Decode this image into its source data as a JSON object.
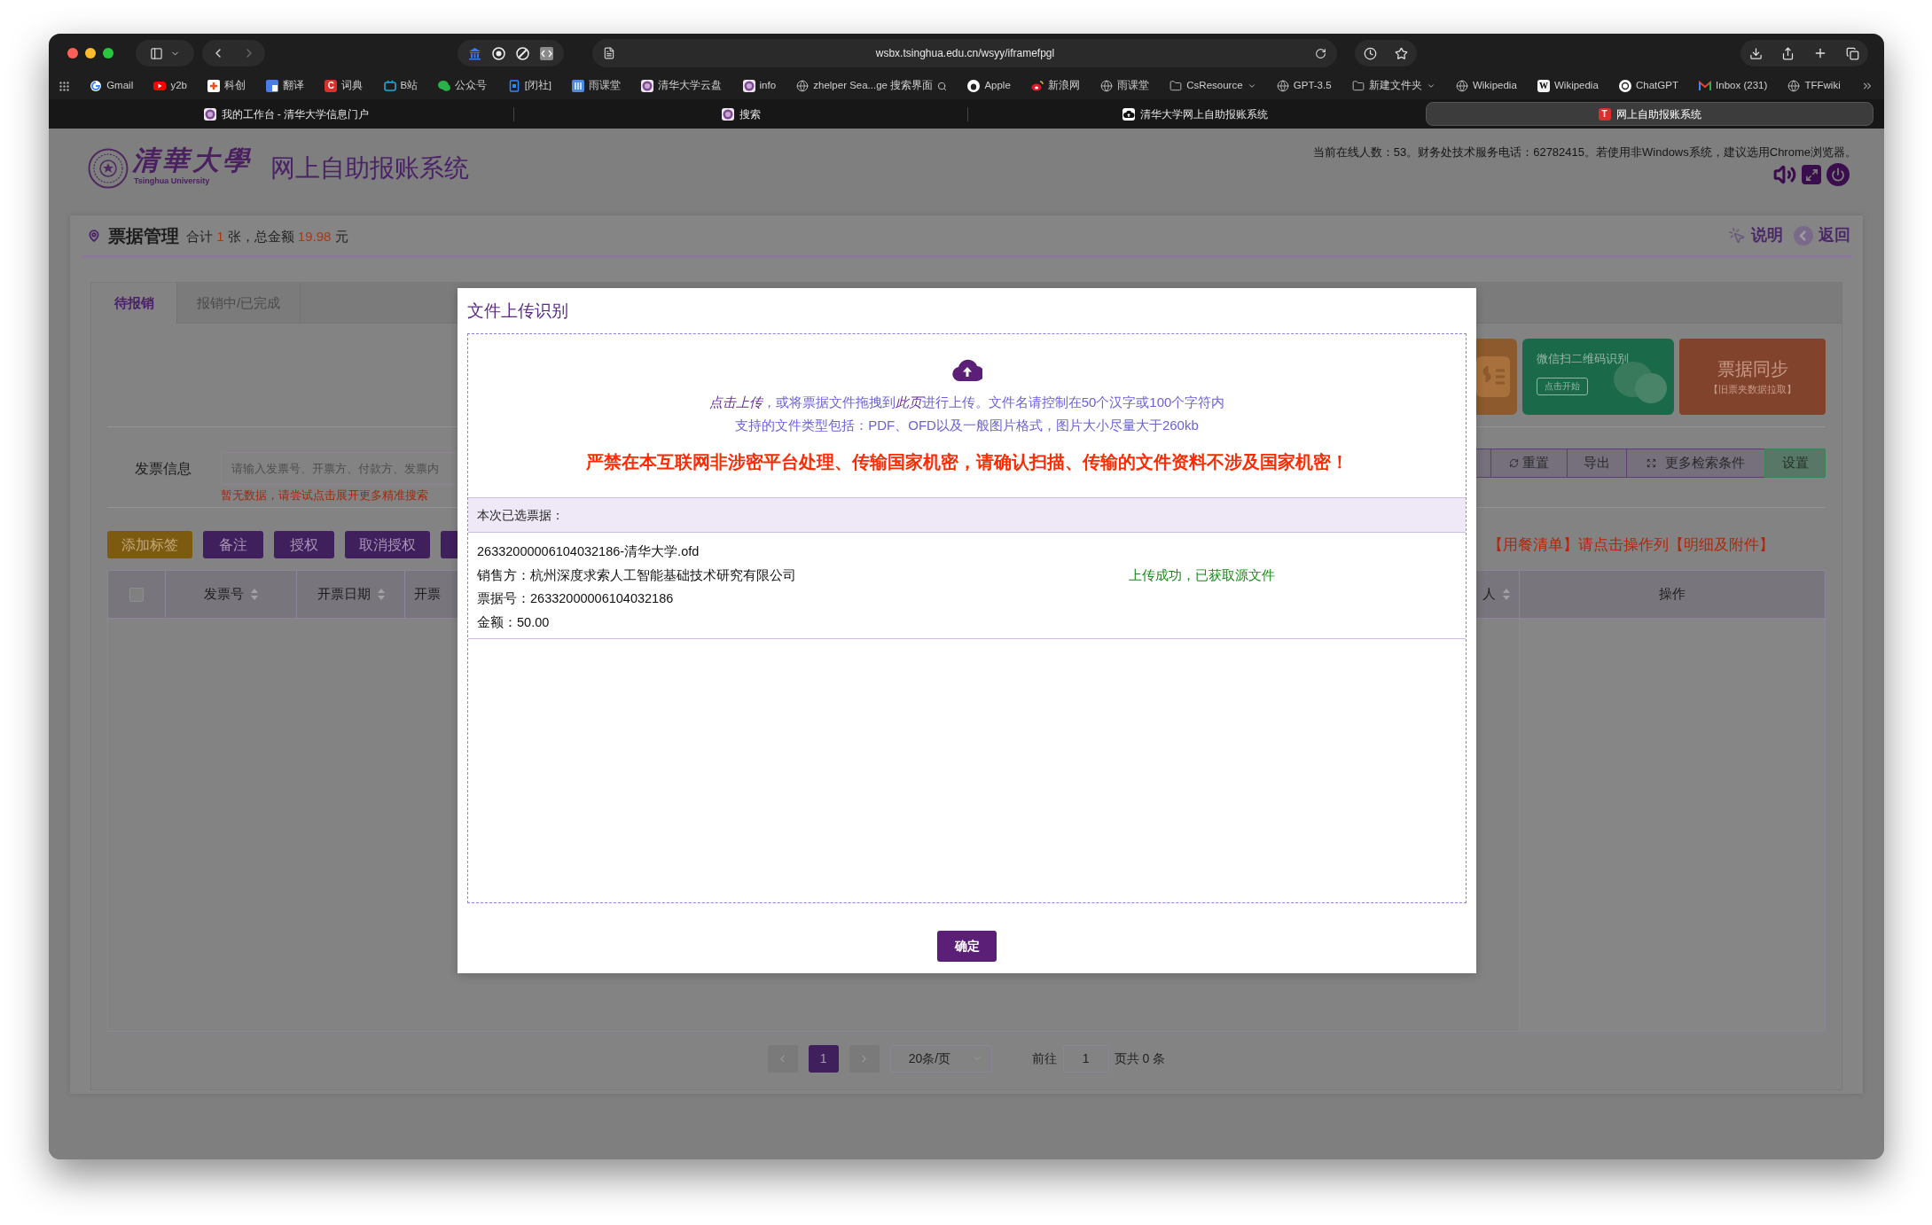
{
  "browser": {
    "url": "wsbx.tsinghua.edu.cn/wsyy/iframefpgl",
    "bookmarks": [
      {
        "label": "Gmail",
        "kind": "google",
        "menu": false,
        "search_mark": false
      },
      {
        "label": "y2b",
        "kind": "youtube",
        "menu": false,
        "search_mark": false
      },
      {
        "label": "科创",
        "kind": "kechuang",
        "menu": false,
        "search_mark": false
      },
      {
        "label": "翻译",
        "kind": "translate",
        "menu": false,
        "search_mark": false
      },
      {
        "label": "词典",
        "kind": "letter",
        "letter": "C",
        "menu": false,
        "search_mark": false
      },
      {
        "label": "B站",
        "kind": "bilibili",
        "menu": false,
        "search_mark": false
      },
      {
        "label": "公众号",
        "kind": "wechat",
        "menu": false,
        "search_mark": false
      },
      {
        "label": "[闭社]",
        "kind": "doc",
        "menu": false,
        "search_mark": false
      },
      {
        "label": "雨课堂",
        "kind": "yuketang",
        "menu": false,
        "search_mark": false
      },
      {
        "label": "清华大学云盘",
        "kind": "seal",
        "menu": false,
        "search_mark": false
      },
      {
        "label": "info",
        "kind": "seal",
        "menu": false,
        "search_mark": false
      },
      {
        "label": "zhelper Sea...ge 搜索界面",
        "kind": "globe",
        "menu": false,
        "search_mark": true
      },
      {
        "label": "Apple",
        "kind": "apple",
        "menu": false,
        "search_mark": false
      },
      {
        "label": "新浪网",
        "kind": "weibo",
        "menu": false,
        "search_mark": false
      },
      {
        "label": "雨课堂",
        "kind": "globe",
        "menu": false,
        "search_mark": false
      },
      {
        "label": "CsResource",
        "kind": "folder",
        "menu": true,
        "search_mark": false
      },
      {
        "label": "GPT-3.5",
        "kind": "globe",
        "menu": false,
        "search_mark": false
      },
      {
        "label": "新建文件夹",
        "kind": "folder",
        "menu": true,
        "search_mark": false
      },
      {
        "label": "Wikipedia",
        "kind": "globe",
        "menu": false,
        "search_mark": false
      },
      {
        "label": "Wikipedia",
        "kind": "letter_light",
        "letter": "W",
        "menu": false,
        "search_mark": false
      },
      {
        "label": "ChatGPT",
        "kind": "chatgpt",
        "menu": false,
        "search_mark": false
      },
      {
        "label": "Inbox (231)",
        "kind": "gmail",
        "menu": false,
        "search_mark": false
      },
      {
        "label": "TFFwiki",
        "kind": "globe",
        "menu": false,
        "search_mark": false
      }
    ],
    "tabs": [
      {
        "title": "我的工作台 - 清华大学信息门户",
        "kind": "seal",
        "selected": false
      },
      {
        "title": "搜索",
        "kind": "seal",
        "selected": false
      },
      {
        "title": "清华大学网上自助报账系统",
        "kind": "cloud",
        "selected": false
      },
      {
        "title": "网上自助报账系统",
        "kind": "letter",
        "letter": "T",
        "selected": true
      }
    ]
  },
  "header": {
    "logo_name": "清華大學",
    "logo_subtitle": "Tsinghua University",
    "title": "网上自助报账系统",
    "notice": "当前在线人数：53。财务处技术服务电话：62782415。若使用非Windows系统，建议选用Chrome浏览器。"
  },
  "card": {
    "title": "票据管理",
    "summary": {
      "prefix": "合计",
      "count": "1",
      "middle": "张，总金额",
      "amount": "19.98",
      "suffix": "元"
    },
    "links": [
      {
        "label": "说明",
        "kind": "help"
      },
      {
        "label": "返回",
        "kind": "back"
      }
    ]
  },
  "tabs": [
    {
      "label": "待报销",
      "selected": true
    },
    {
      "label": "报销中/已完成",
      "selected": false
    }
  ],
  "action_cards": [
    {
      "kind": "receipt",
      "color": "#8c5a2c"
    },
    {
      "kind": "wechat",
      "title": "微信扫二维码识别",
      "button": "点击开始",
      "color": "#1a6a4a"
    },
    {
      "kind": "sync",
      "title": "票据同步",
      "subtitle": "【旧票夹数据拉取】",
      "color": "#82432d"
    }
  ],
  "search": {
    "label": "发票信息",
    "placeholder": "请输入发票号、开票方、付款方、发票内",
    "hint": "暂无数据，请尝试点击展开更多精准搜索"
  },
  "search_buttons": [
    {
      "label": "重置",
      "kind": "reset"
    },
    {
      "label": "导出",
      "kind": "plain"
    },
    {
      "label": "更多检索条件",
      "kind": "expand"
    },
    {
      "label": "设置",
      "kind": "settings"
    }
  ],
  "action_buttons": [
    {
      "label": "添加标签",
      "kind": "tag"
    },
    {
      "label": "备注",
      "kind": "primary"
    },
    {
      "label": "授权",
      "kind": "primary"
    },
    {
      "label": "取消授权",
      "kind": "primary"
    }
  ],
  "table_notice": "【用餐清单】请点击操作列【明细及附件】",
  "table": {
    "select_all_checked": false,
    "columns": [
      {
        "label": "发票号",
        "sortable": true
      },
      {
        "label": "开票日期",
        "sortable": true
      },
      {
        "label": "开票",
        "sortable": false
      }
    ],
    "right_columns": [
      {
        "label": "人",
        "sortable": true
      },
      {
        "label": "操作",
        "sortable": false
      }
    ]
  },
  "pagination": {
    "pages": [
      {
        "label": "1",
        "selected": true
      }
    ],
    "page_size": "20条/页",
    "goto_label": "前往",
    "goto_value": "1",
    "total": "页共 0 条"
  },
  "modal": {
    "title": "文件上传识别",
    "upload_line": [
      {
        "text": "点击上传",
        "italic": true
      },
      {
        "text": "，或将票据文件拖拽到",
        "italic": false
      },
      {
        "text": "此页",
        "italic": true
      },
      {
        "text": "进行上传。文件名请控制在50个汉字或100个字符内",
        "italic": false
      }
    ],
    "types_line": "支持的文件类型包括：PDF、OFD以及一般图片格式，图片大小尽量大于260kb",
    "warning": "严禁在本互联网非涉密平台处理、传输国家机密，请确认扫描、传输的文件资料不涉及国家机密！",
    "selected_header": "本次已选票据：",
    "files": [
      {
        "name": "26332000006104032186-清华大学.ofd",
        "seller": "销售方：杭州深度求索人工智能基础技术研究有限公司",
        "number": "票据号：26332000006104032186",
        "amount": "金额：50.00",
        "status": "上传成功，已获取源文件",
        "success": true
      }
    ],
    "confirm": "确定"
  }
}
